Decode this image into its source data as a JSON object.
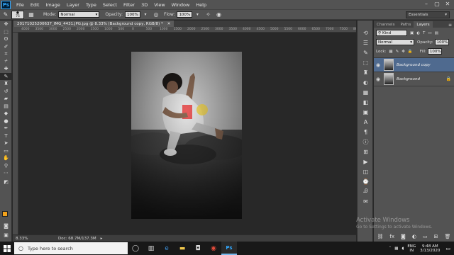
{
  "menubar": {
    "items": [
      "File",
      "Edit",
      "Image",
      "Layer",
      "Type",
      "Select",
      "Filter",
      "3D",
      "View",
      "Window",
      "Help"
    ],
    "workspace": "Essentials"
  },
  "options": {
    "brush_size": "75",
    "mode_label": "Mode:",
    "mode_value": "Normal",
    "opacity_label": "Opacity:",
    "opacity_value": "100%",
    "flow_label": "Flow:",
    "flow_value": "100%"
  },
  "document": {
    "tab_title": "20171025200637_IMG_4431.JPG.jpg @ 8.33% (Background copy, RGB/8) *",
    "zoom": "8.33%",
    "doc_size": "Doc: 68.7M/137.3M",
    "ruler_ticks": [
      "4000",
      "3500",
      "3000",
      "2500",
      "2000",
      "1500",
      "1000",
      "500",
      "0",
      "500",
      "1000",
      "1500",
      "2000",
      "2500",
      "3000",
      "3500",
      "4000",
      "4500",
      "5000",
      "5500",
      "6000",
      "6500",
      "7000",
      "7500",
      "8000"
    ]
  },
  "layers_panel": {
    "tabs": [
      "Channels",
      "Paths",
      "Layers"
    ],
    "kind_label": "Kind",
    "blend_mode": "Normal",
    "opacity_label": "Opacity:",
    "opacity_value": "100%",
    "lock_label": "Lock:",
    "fill_label": "Fill:",
    "fill_value": "100%",
    "layers": [
      {
        "name": "Background copy"
      },
      {
        "name": "Background"
      }
    ]
  },
  "watermark": {
    "title": "Activate Windows",
    "subtitle": "Go to Settings to activate Windows."
  },
  "taskbar": {
    "search_placeholder": "Type here to search",
    "lang": "ENG",
    "region": "IN",
    "time": "9:48 AM",
    "date": "3/13/2020"
  },
  "colors": {
    "foreground": "#f3a21b",
    "background": "#ffffff",
    "selection": "#4f6a8f"
  }
}
